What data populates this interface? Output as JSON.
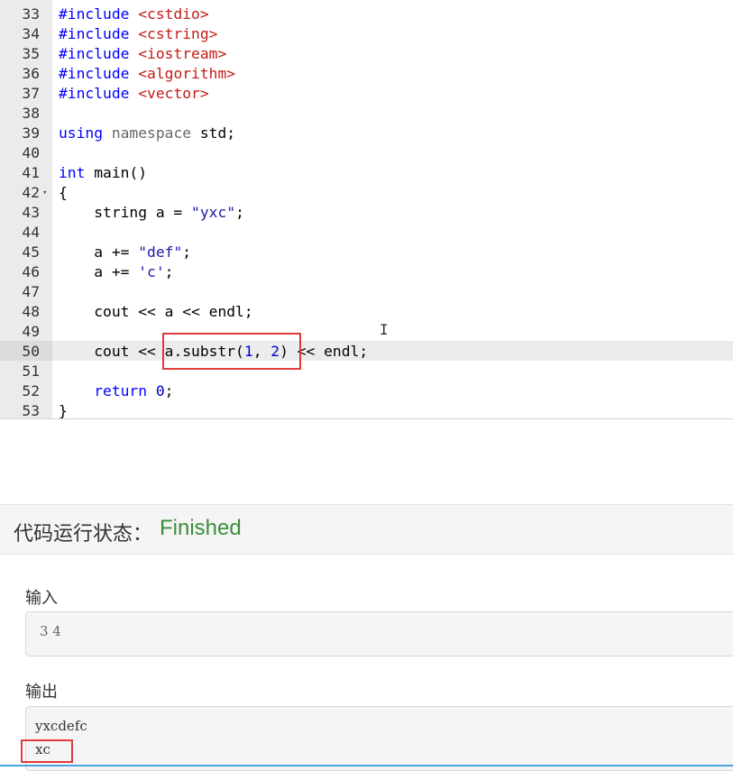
{
  "editor": {
    "lines": [
      {
        "num": "33",
        "tokens": [
          {
            "t": "#include ",
            "c": "inc"
          },
          {
            "t": "<cstdio>",
            "c": "hdr"
          }
        ]
      },
      {
        "num": "34",
        "tokens": [
          {
            "t": "#include ",
            "c": "inc"
          },
          {
            "t": "<cstring>",
            "c": "hdr"
          }
        ]
      },
      {
        "num": "35",
        "tokens": [
          {
            "t": "#include ",
            "c": "inc"
          },
          {
            "t": "<iostream>",
            "c": "hdr"
          }
        ]
      },
      {
        "num": "36",
        "tokens": [
          {
            "t": "#include ",
            "c": "inc"
          },
          {
            "t": "<algorithm>",
            "c": "hdr"
          }
        ]
      },
      {
        "num": "37",
        "tokens": [
          {
            "t": "#include ",
            "c": "inc"
          },
          {
            "t": "<vector>",
            "c": "hdr"
          }
        ]
      },
      {
        "num": "38",
        "tokens": []
      },
      {
        "num": "39",
        "tokens": [
          {
            "t": "using ",
            "c": "kw"
          },
          {
            "t": "namespace ",
            "c": "ns"
          },
          {
            "t": "std;",
            "c": ""
          }
        ]
      },
      {
        "num": "40",
        "tokens": []
      },
      {
        "num": "41",
        "tokens": [
          {
            "t": "int ",
            "c": "typ"
          },
          {
            "t": "main()",
            "c": ""
          }
        ]
      },
      {
        "num": "42",
        "fold": true,
        "tokens": [
          {
            "t": "{",
            "c": ""
          }
        ]
      },
      {
        "num": "43",
        "tokens": [
          {
            "t": "    string a = ",
            "c": ""
          },
          {
            "t": "\"yxc\"",
            "c": "str"
          },
          {
            "t": ";",
            "c": ""
          }
        ]
      },
      {
        "num": "44",
        "tokens": []
      },
      {
        "num": "45",
        "tokens": [
          {
            "t": "    a += ",
            "c": ""
          },
          {
            "t": "\"def\"",
            "c": "str"
          },
          {
            "t": ";",
            "c": ""
          }
        ]
      },
      {
        "num": "46",
        "tokens": [
          {
            "t": "    a += ",
            "c": ""
          },
          {
            "t": "'c'",
            "c": "str"
          },
          {
            "t": ";",
            "c": ""
          }
        ]
      },
      {
        "num": "47",
        "tokens": []
      },
      {
        "num": "48",
        "tokens": [
          {
            "t": "    cout << a << endl;",
            "c": ""
          }
        ]
      },
      {
        "num": "49",
        "tokens": []
      },
      {
        "num": "50",
        "tokens": [
          {
            "t": "    cout << ",
            "c": ""
          },
          {
            "t": "a.substr(",
            "c": ""
          },
          {
            "t": "1",
            "c": "num"
          },
          {
            "t": ", ",
            "c": ""
          },
          {
            "t": "2",
            "c": "num"
          },
          {
            "t": ")",
            "c": ""
          },
          {
            "t": " << endl;",
            "c": ""
          }
        ]
      },
      {
        "num": "51",
        "tokens": []
      },
      {
        "num": "52",
        "tokens": [
          {
            "t": "    return ",
            "c": "kw"
          },
          {
            "t": "0",
            "c": "num"
          },
          {
            "t": ";",
            "c": ""
          }
        ]
      },
      {
        "num": "53",
        "tokens": [
          {
            "t": "}",
            "c": ""
          }
        ]
      }
    ],
    "current_line": "50",
    "fold_icon": "fold-arrow-icon",
    "cursor_icon": "text-cursor-icon",
    "highlight_color": "#e03a3a"
  },
  "status": {
    "label": "代码运行状态：",
    "value": "Finished",
    "value_color": "#3c8d3c"
  },
  "input": {
    "label": "输入",
    "value": "3 4"
  },
  "output": {
    "label": "输出",
    "lines": [
      "yxcdefc",
      "xc"
    ]
  }
}
